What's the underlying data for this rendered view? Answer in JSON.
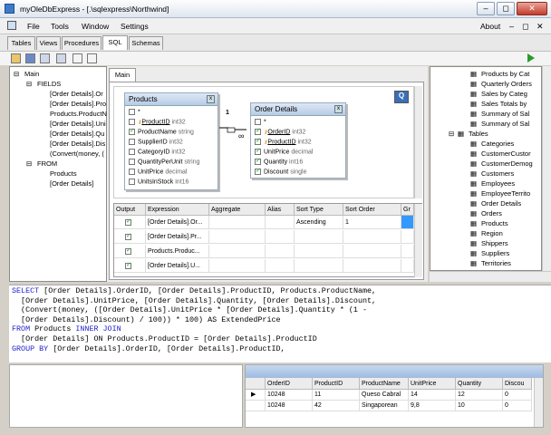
{
  "window": {
    "title": "myOleDbExpress - [.\\sqlexpress\\Northwind]",
    "minimize": "–",
    "restore": "◻",
    "close": "✕"
  },
  "menu": [
    "File",
    "Tools",
    "Window",
    "Settings",
    "About"
  ],
  "tabs": [
    "Tables",
    "Views",
    "Procedures",
    "SQL",
    "Schemas"
  ],
  "active_tab": "SQL",
  "left_tree": {
    "main": "Main",
    "fields": "FIELDS",
    "field_items": [
      "[Order Details].Or",
      "[Order Details].Pro",
      "Products.ProductN",
      "[Order Details].Uni",
      "[Order Details].Qu",
      "[Order Details].Dis",
      "(Convert(money, ("
    ],
    "from": "FROM",
    "from_items": [
      "Products",
      "[Order Details]"
    ]
  },
  "designer": {
    "tab": "Main",
    "products_table": {
      "title": "Products",
      "columns": [
        [
          "*",
          ""
        ],
        [
          "ProductID",
          "int32"
        ],
        [
          "ProductName",
          "string"
        ],
        [
          "SupplierID",
          "int32"
        ],
        [
          "CategoryID",
          "int32"
        ],
        [
          "QuantityPerUnit",
          "string"
        ],
        [
          "UnitPrice",
          "decimal"
        ],
        [
          "UnitsInStock",
          "int16"
        ],
        [
          "UnitsOnOrder",
          "int16"
        ]
      ]
    },
    "orderdetails_table": {
      "title": "Order Details",
      "columns": [
        [
          "*",
          ""
        ],
        [
          "OrderID",
          "int32"
        ],
        [
          "ProductID",
          "int32"
        ],
        [
          "UnitPrice",
          "decimal"
        ],
        [
          "Quantity",
          "int16"
        ],
        [
          "Discount",
          "single"
        ]
      ]
    },
    "join_label_left": "1",
    "join_label_right": "∞",
    "grid_headers": [
      "Output",
      "Expression",
      "Aggregate",
      "Alias",
      "Sort Type",
      "Sort Order",
      "Gr"
    ],
    "grid_rows": [
      {
        "expression": "[Order Details].Or...",
        "sort_type": "Ascending",
        "sort_order": "1"
      },
      {
        "expression": "[Order Details].Pr...",
        "sort_type": "",
        "sort_order": ""
      },
      {
        "expression": "Products.Produc...",
        "sort_type": "",
        "sort_order": ""
      },
      {
        "expression": "[Order Details].U...",
        "sort_type": "",
        "sort_order": ""
      }
    ]
  },
  "right_tree": {
    "views": [
      "Products by Cat",
      "Quarterly Orders",
      "Sales by Categ",
      "Sales Totals by",
      "Summary of Sal",
      "Summary of Sal"
    ],
    "tables_label": "Tables",
    "tables": [
      "Categories",
      "CustomerCustor",
      "CustomerDemog",
      "Customers",
      "Employees",
      "EmployeeTerrito",
      "Order Details",
      "Orders",
      "Products",
      "Region",
      "Shippers",
      "Suppliers",
      "Territories"
    ]
  },
  "sql_lines": [
    "SELECT [Order Details].OrderID, [Order Details].ProductID, Products.ProductName,",
    "  [Order Details].UnitPrice, [Order Details].Quantity, [Order Details].Discount,",
    "  (Convert(money, ([Order Details].UnitPrice * [Order Details].Quantity * (1 -",
    "  [Order Details].Discount) / 100)) * 100) AS ExtendedPrice",
    "FROM Products INNER JOIN",
    "  [Order Details] ON Products.ProductID = [Order Details].ProductID",
    "GROUP BY [Order Details].OrderID, [Order Details].ProductID,"
  ],
  "results": {
    "headers": [
      "OrderID",
      "ProductID",
      "ProductName",
      "UnitPrice",
      "Quantity",
      "Discou"
    ],
    "rows": [
      [
        "10248",
        "11",
        "Queso Cabral",
        "14",
        "12",
        "0"
      ],
      [
        "10248",
        "42",
        "Singaporean",
        "9,8",
        "10",
        "0"
      ]
    ]
  },
  "colors": {
    "accent": "#3399ff",
    "keyword": "#2222cc",
    "selected_cell": "#3399ff"
  }
}
